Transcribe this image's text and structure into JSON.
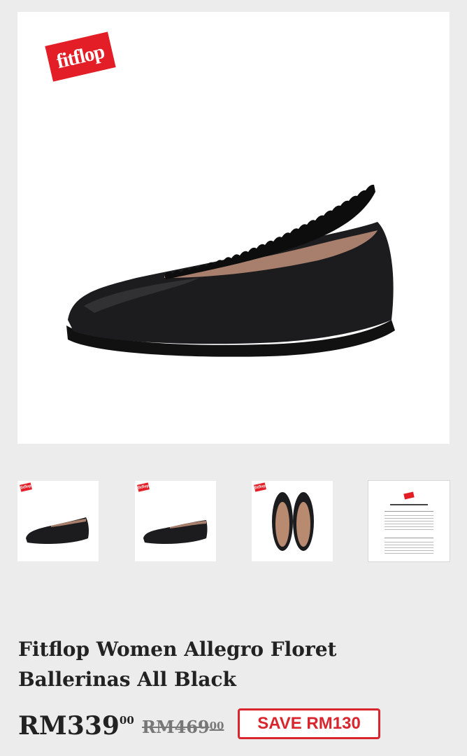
{
  "product": {
    "brand_logo_text": "fitflop",
    "title": "Fitflop Women Allegro Floret Ballerinas All Black",
    "price": {
      "currency_main": "RM339",
      "cents": "00"
    },
    "original_price": {
      "currency_main": "RM469",
      "cents": "00"
    },
    "save_label": "SAVE RM130"
  },
  "gallery": {
    "thumbnails": [
      {
        "name": "thumb-side-1",
        "mini_logo": "fitflop"
      },
      {
        "name": "thumb-side-2",
        "mini_logo": "fitflop"
      },
      {
        "name": "thumb-top-pair",
        "mini_logo": "fitflop"
      },
      {
        "name": "thumb-size-chart",
        "heading": "WHAT SIZE ARE YOU?"
      }
    ]
  },
  "colors": {
    "background": "#ececec",
    "brand_red": "#e41e26",
    "save_red": "#d9262e",
    "text_dark": "#222222",
    "text_muted": "#777777"
  }
}
